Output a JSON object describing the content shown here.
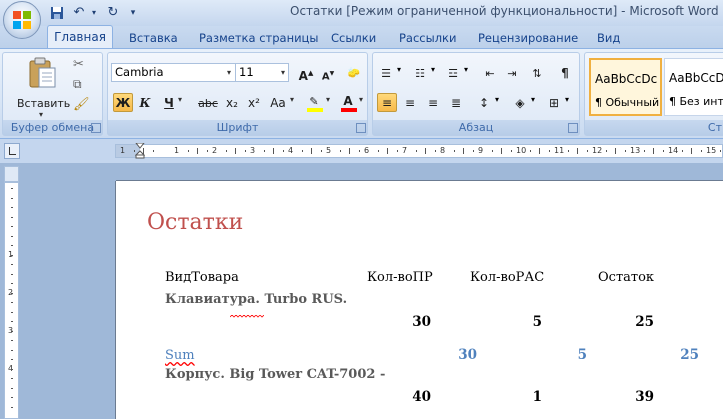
{
  "window": {
    "title": "Остатки [Режим ограниченной функциональности] - Microsoft Word"
  },
  "qat": {
    "save_icon": "save-icon",
    "undo_icon": "undo-icon",
    "redo_icon": "redo-icon",
    "customize_icon": "qat-customize-icon"
  },
  "tabs": [
    "Главная",
    "Вставка",
    "Разметка страницы",
    "Ссылки",
    "Рассылки",
    "Рецензирование",
    "Вид"
  ],
  "clipboard": {
    "paste_label": "Вставить",
    "group_label": "Буфер обмена"
  },
  "font": {
    "group_label": "Шрифт",
    "family": "Cambria",
    "size": "11",
    "bold": "Ж",
    "italic": "К",
    "underline": "Ч",
    "strike": "abc",
    "subscript": "x₂",
    "superscript": "x²",
    "case": "Aa",
    "grow": "A",
    "shrink": "A",
    "color_letter": "A",
    "highlight_color": "#ffff00",
    "font_color": "#ff0000"
  },
  "paragraph": {
    "group_label": "Абзац",
    "pilcrow": "¶"
  },
  "styles": {
    "group_label": "Ст",
    "tiles": [
      {
        "preview": "AaBbCcDc",
        "name": "¶ Обычный",
        "selected": true
      },
      {
        "preview": "AaBbCcDc",
        "name": "¶ Без инте...",
        "selected": false
      }
    ]
  },
  "ruler": {
    "ticks": [
      "1",
      "1",
      "2",
      "3",
      "4",
      "5",
      "6",
      "7",
      "8",
      "9",
      "10",
      "11",
      "12",
      "13",
      "14",
      "15"
    ]
  },
  "vruler": {
    "ticks": [
      "1",
      "2",
      "3",
      "4"
    ]
  },
  "document": {
    "title": "Остатки",
    "headers": [
      "ВидТовара",
      "Кол-воПР",
      "Кол-воРАС",
      "Остаток"
    ],
    "groups": [
      {
        "name": "Клавиатура. Turbo RUS.",
        "values": [
          "30",
          "5",
          "25"
        ],
        "sum_label": "Sum",
        "sum_values": [
          "30",
          "5",
          "25"
        ]
      },
      {
        "name": "Корпус. Big Tower CAT-7002 -",
        "values": [
          "40",
          "1",
          "39"
        ]
      }
    ]
  }
}
